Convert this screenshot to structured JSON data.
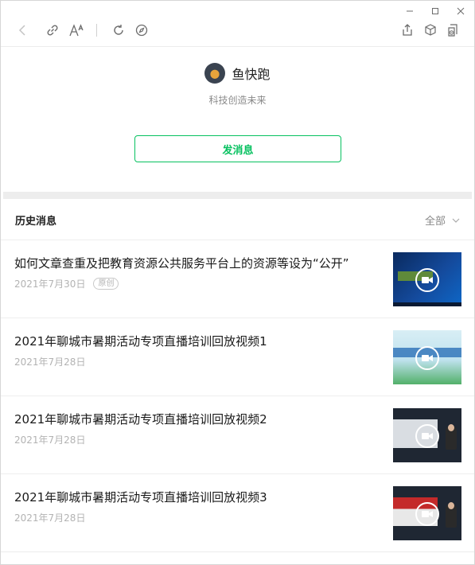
{
  "window": {
    "controls": [
      "minimize-icon",
      "maximize-icon",
      "close-icon"
    ]
  },
  "toolbar": {
    "icons": [
      "back-icon",
      "link-icon",
      "font-size-icon",
      "refresh-icon",
      "compass-icon",
      "share-icon",
      "cube-icon",
      "minus-doc-icon"
    ]
  },
  "profile": {
    "name": "鱼快跑",
    "motto": "科技创造未来",
    "message_button": "发消息"
  },
  "history": {
    "title": "历史消息",
    "filter": "全部"
  },
  "articles": [
    {
      "title": "如何文章查重及把教育资源公共服务平台上的资源等设为“公开”",
      "date": "2021年7月30日",
      "badge": "原创"
    },
    {
      "title": "2021年聊城市暑期活动专项直播培训回放视频1",
      "date": "2021年7月28日"
    },
    {
      "title": "2021年聊城市暑期活动专项直播培训回放视频2",
      "date": "2021年7月28日"
    },
    {
      "title": "2021年聊城市暑期活动专项直播培训回放视频3",
      "date": "2021年7月28日"
    }
  ],
  "colors": {
    "accent": "#07c160",
    "muted": "#b3b3b3"
  }
}
